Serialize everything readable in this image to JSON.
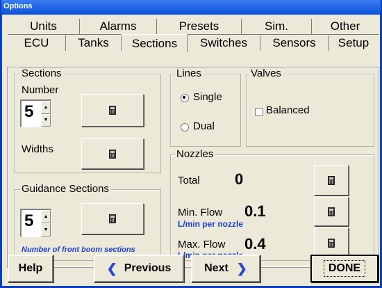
{
  "window": {
    "title": "Options"
  },
  "tabs_row1": [
    "Units",
    "Alarms",
    "Presets",
    "Sim.",
    "Other"
  ],
  "tabs_row2": [
    "ECU",
    "Tanks",
    "Sections",
    "Switches",
    "Sensors",
    "Setup"
  ],
  "active_tab": "Sections",
  "sections": {
    "legend": "Sections",
    "number_label": "Number",
    "number_value": "5",
    "widths_label": "Widths"
  },
  "guidance": {
    "legend": "Guidance Sections",
    "value": "5",
    "note": "Number of front boom sections"
  },
  "lines": {
    "legend": "Lines",
    "single_label": "Single",
    "dual_label": "Dual",
    "selected": "Single"
  },
  "valves": {
    "legend": "Valves",
    "balanced_label": "Balanced",
    "balanced_checked": false
  },
  "nozzles": {
    "legend": "Nozzles",
    "total_label": "Total",
    "total_value": "0",
    "min_flow_label": "Min. Flow",
    "min_flow_value": "0.1",
    "min_flow_unit": "L/min per nozzle",
    "max_flow_label": "Max. Flow",
    "max_flow_value": "0.4",
    "max_flow_unit": "L/min per nozzle"
  },
  "footer": {
    "help_label": "Help",
    "previous_label": "Previous",
    "next_label": "Next",
    "done_label": "DONE"
  },
  "icons": {
    "calculator": "calculator-icon",
    "prev": "chevron-left-icon",
    "next": "chevron-right-icon"
  },
  "colors": {
    "titlebar": "#0b52d8",
    "accent_blue": "#1a3fd6",
    "window_bg": "#ece9d8"
  }
}
